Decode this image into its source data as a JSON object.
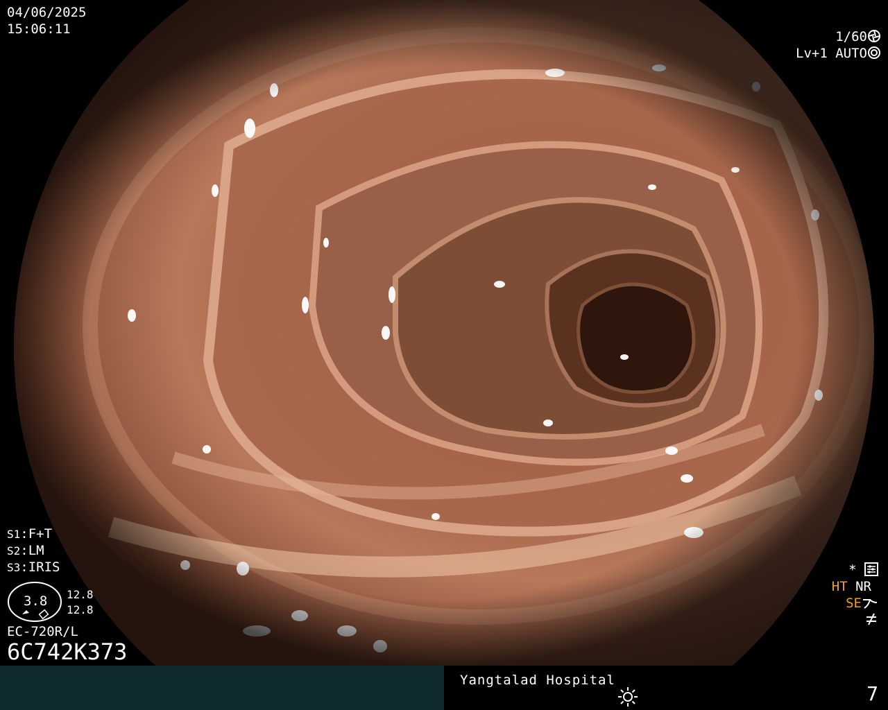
{
  "overlay": {
    "date": "04/06/2025",
    "time": "15:06:11",
    "shutter": "1/60",
    "level": "Lv+1",
    "auto": "AUTO",
    "settings": [
      {
        "key": "S1",
        "value": "F+T"
      },
      {
        "key": "S2",
        "value": "LM"
      },
      {
        "key": "S3",
        "value": "IRIS"
      }
    ],
    "gauge_value": "3.8",
    "gauge_readings": [
      "12.8",
      "12.8"
    ],
    "scope_model": "EC-720R/L",
    "serial": "6C742K373",
    "right_status": {
      "star": "*",
      "ht": "HT",
      "nr": "NR",
      "se": "SE",
      "ht_color": "#f0a020",
      "se_color": "#f0a020"
    }
  },
  "bottom_bar": {
    "hospital": "Yangtalad Hospital",
    "number": "7",
    "left_color": "#0f2a2c"
  },
  "icons": [
    "aperture-icon",
    "iris-icon",
    "settings-sliders-icon",
    "mode-curve-icon",
    "not-equal-icon",
    "sun-icon"
  ]
}
